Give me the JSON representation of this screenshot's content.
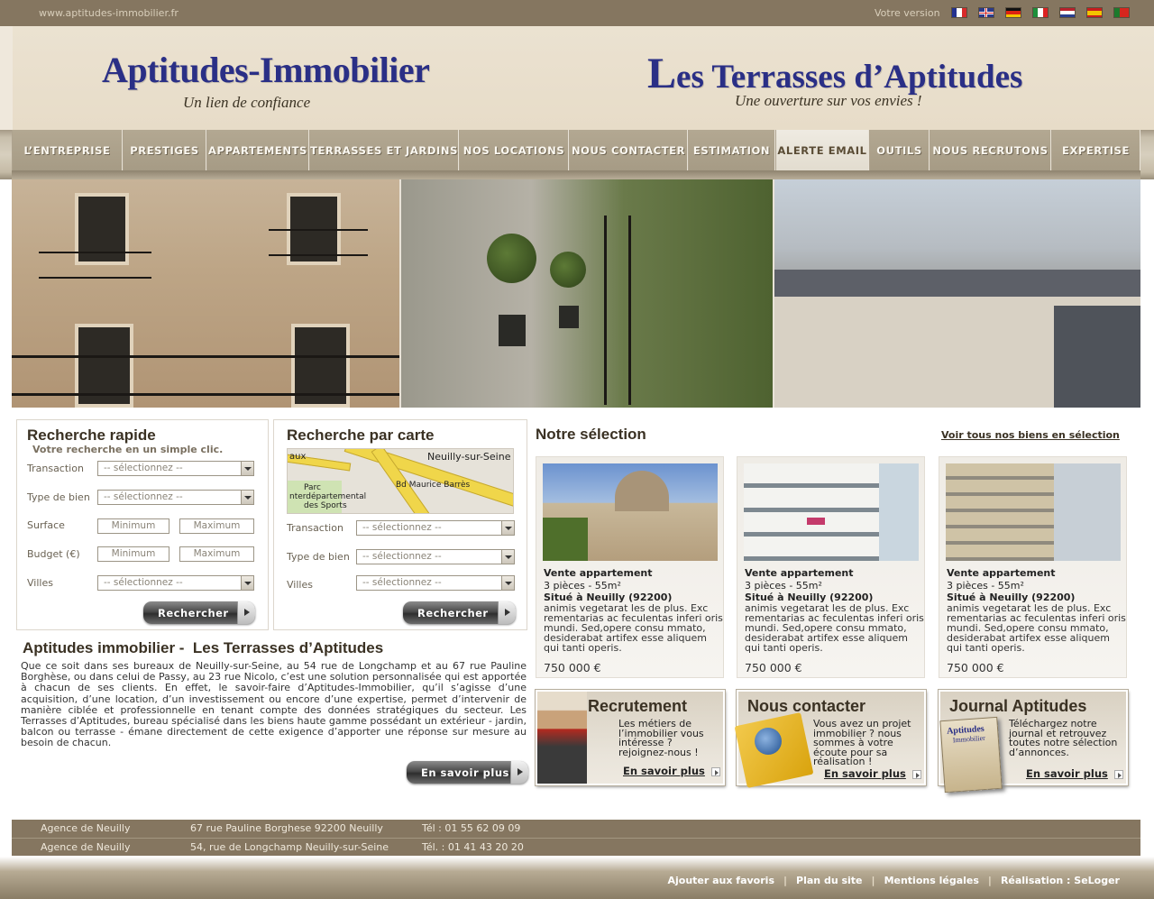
{
  "topbar": {
    "url": "www.aptitudes-immobilier.fr",
    "version_label": "Votre version"
  },
  "header": {
    "logo_left": "Aptitudes-Immobilier",
    "tagline_left": "Un lien de confiance",
    "logo_right_cap": "L",
    "logo_right_rest": "es Terrasses d’Aptitudes",
    "tagline_right": "Une ouverture sur vos envies !"
  },
  "nav": {
    "items": [
      "L’ENTREPRISE",
      "PRESTIGES",
      "APPARTEMENTS",
      "TERRASSES ET JARDINS",
      "NOS LOCATIONS",
      "NOUS CONTACTER",
      "ESTIMATION",
      "ALERTE EMAIL",
      "OUTILS",
      "NOUS RECRUTONS",
      "EXPERTISE"
    ],
    "active": "ALERTE EMAIL"
  },
  "quick_search": {
    "title": "Recherche rapide",
    "subtitle": "Votre recherche en un simple clic.",
    "transaction_label": "Transaction",
    "type_label": "Type de bien",
    "surface_label": "Surface",
    "budget_label": "Budget (€)",
    "villes_label": "Villes",
    "select_placeholder": "-- sélectionnez --",
    "min_placeholder": "Minimum",
    "max_placeholder": "Maximum",
    "button": "Rechercher"
  },
  "map_search": {
    "title": "Recherche par carte",
    "map_labels": {
      "city": "Neuilly-sur-Seine",
      "aux": "aux",
      "street": "Bd Maurice Barrès",
      "park1": "Parc",
      "park2": "nterdépartemental",
      "park3": "des Sports"
    },
    "transaction_label": "Transaction",
    "type_label": "Type de bien",
    "villes_label": "Villes",
    "select_placeholder": "-- sélectionnez --",
    "button": "Rechercher"
  },
  "intro": {
    "title": "Aptitudes immobilier -  Les Terrasses d’Aptitudes",
    "text": "Que ce soit dans ses bureaux de Neuilly-sur-Seine, au 54 rue de Longchamp et au 67 rue Pauline Borghèse, ou dans celui de Passy, au 23 rue Nicolo, c’est une solution personnalisée qui est apportée à chacun de ses clients. En effet, le savoir-faire d’Aptitudes-Immobilier, qu’il s’agisse d’une acquisition, d’une location, d’un investissement ou encore d’une expertise, permet d’intervenir de manière ciblée et professionnelle en tenant compte des données stratégiques du secteur. Les Terrasses d’Aptitudes, bureau spécialisé dans les biens haute gamme possédant un extérieur - jardin, balcon ou terrasse - émane directement de cette exigence d’apporter une réponse sur mesure au besoin de chacun.",
    "button": "En savoir plus"
  },
  "selection": {
    "title": "Notre sélection",
    "link": "Voir tous nos biens en sélection",
    "cards": [
      {
        "type": "Vente appartement",
        "rooms": "3 pièces - 55m²",
        "location": "Situé à Neuilly (92200)",
        "desc": "animis vegetarat les de plus. Exc rementarias ac feculentas inferi oris mundi. Sed,opere consu mmato, desiderabat artifex esse aliquem qui tanti operis.",
        "price": "750 000 €"
      },
      {
        "type": "Vente appartement",
        "rooms": "3 pièces - 55m²",
        "location": "Situé à Neuilly (92200)",
        "desc": "animis vegetarat les de plus. Exc rementarias ac feculentas inferi oris mundi. Sed,opere consu mmato, desiderabat artifex esse aliquem qui tanti operis.",
        "price": "750 000 €"
      },
      {
        "type": "Vente appartement",
        "rooms": "3 pièces - 55m²",
        "location": "Situé à Neuilly (92200)",
        "desc": "animis vegetarat les de plus. Exc rementarias ac feculentas inferi oris mundi. Sed,opere consu mmato, desiderabat artifex esse aliquem qui tanti operis.",
        "price": "750 000 €"
      }
    ]
  },
  "promos": {
    "recruit": {
      "title": "Recrutement",
      "text": "Les métiers de l’immobilier vous intéresse ? rejoignez-nous !",
      "more": "En savoir plus"
    },
    "contact": {
      "title": "Nous contacter",
      "text": "Vous avez un projet immobilier ? nous sommes à votre écoute pour sa réalisation !",
      "more": "En savoir plus"
    },
    "journal": {
      "title": "Journal Aptitudes",
      "text": "Téléchargez notre journal et retrouvez toutes notre sélection d’annonces.",
      "more": "En savoir plus",
      "cover_title": "Aptitudes",
      "cover_sub": "Immobilier"
    }
  },
  "agencies": [
    {
      "name": "Agence de Neuilly",
      "address": "67 rue Pauline Borghese 92200 Neuilly",
      "tel": "Tél : 01 55 62 09 09"
    },
    {
      "name": "Agence de Neuilly",
      "address": "54, rue de Longchamp Neuilly-sur-Seine",
      "tel": "Tél. : 01 41 43 20 20"
    }
  ],
  "footer": {
    "links": [
      "Ajouter aux favoris",
      "Plan du site",
      "Mentions légales",
      "Réalisation : SeLoger"
    ],
    "separator": "|"
  },
  "colors": {
    "brand_brown": "#857660",
    "logo_blue": "#2a2f86",
    "header_beige": "#ebe2d1"
  }
}
